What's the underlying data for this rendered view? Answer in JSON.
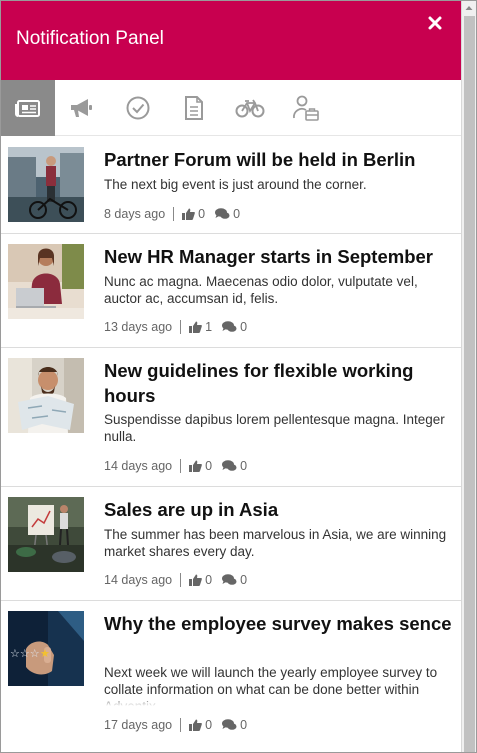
{
  "header": {
    "title": "Notification Panel"
  },
  "tabs": [
    {
      "icon": "newspaper-icon",
      "active": true
    },
    {
      "icon": "megaphone-icon",
      "active": false
    },
    {
      "icon": "check-circle-icon",
      "active": false
    },
    {
      "icon": "document-icon",
      "active": false
    },
    {
      "icon": "bicycle-icon",
      "active": false
    },
    {
      "icon": "user-briefcase-icon",
      "active": false
    }
  ],
  "items": [
    {
      "title": "Partner Forum will be held in Berlin",
      "text": "The next big event is just around the corner.",
      "date": "8 days ago",
      "likes": "0",
      "comments": "0"
    },
    {
      "title": "New HR Manager starts in September",
      "text": "Nunc ac magna. Maecenas odio dolor, vulputate vel, auctor ac, accumsan id, felis.",
      "date": "13 days ago",
      "likes": "1",
      "comments": "0"
    },
    {
      "title": "New guidelines for flexible working hours",
      "text": "Suspendisse dapibus lorem pellentesque magna. Integer nulla.",
      "date": "14 days ago",
      "likes": "0",
      "comments": "0"
    },
    {
      "title": "Sales are up in Asia",
      "text": "The summer has been marvelous in Asia, we are winning market shares every day.",
      "date": "14 days ago",
      "likes": "0",
      "comments": "0"
    },
    {
      "title": "Why the employee survey makes sence",
      "text": "Next week we will launch the yearly employee survey to collate information on what can be done better within Adventix.",
      "date": "17 days ago",
      "likes": "0",
      "comments": "0"
    }
  ],
  "colors": {
    "header": "#c8004f",
    "active_tab": "#8a8a8a"
  }
}
